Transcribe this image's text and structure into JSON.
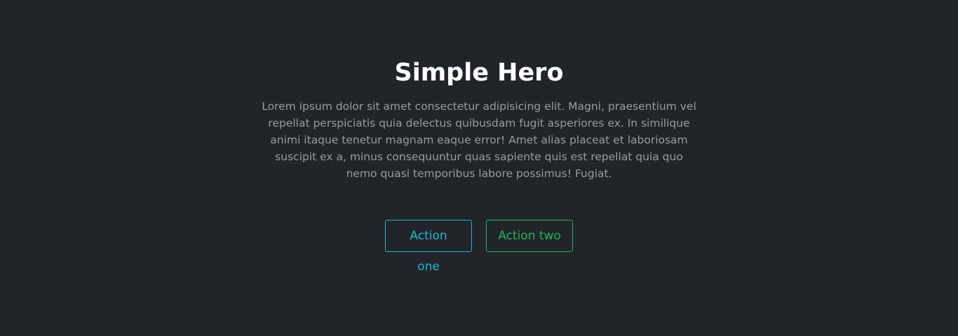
{
  "hero": {
    "title": "Simple Hero",
    "text": "Lorem ipsum dolor sit amet consectetur adipisicing elit. Magni, praesentium vel repellat perspiciatis quia delectus quibusdam fugit asperiores ex. In similique animi itaque tenetur magnam eaque error! Amet alias placeat et laboriosam suscipit ex a, minus consequuntur quas sapiente quis est repellat quia quo nemo quasi temporibus labore possimus! Fugiat."
  },
  "actions": {
    "one_label": "Action one",
    "two_label": "Action two"
  },
  "colors": {
    "background": "#212529",
    "title": "#ffffff",
    "text": "#979ca1",
    "action_one": "#22b5d3",
    "action_two": "#25b35a"
  }
}
